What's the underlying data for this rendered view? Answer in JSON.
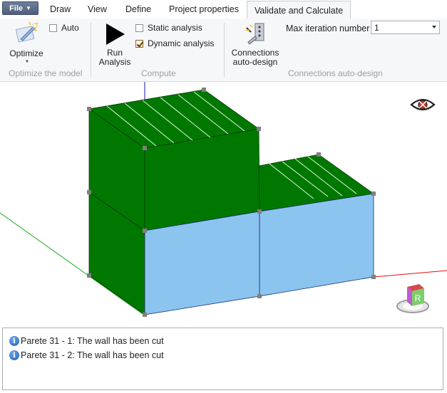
{
  "file_menu": {
    "label": "File"
  },
  "tabs": [
    "Draw",
    "View",
    "Define",
    "Project properties",
    "Validate and Calculate"
  ],
  "ribbon": {
    "optimize": {
      "label": "Optimize",
      "auto_label": "Auto",
      "auto_checked": false,
      "group_label": "Optimize the model"
    },
    "compute": {
      "run_line1": "Run",
      "run_line2": "Analysis",
      "static_label": "Static analysis",
      "static_checked": false,
      "dynamic_label": "Dynamic analysis",
      "dynamic_checked": true,
      "group_label": "Compute"
    },
    "connections": {
      "line1": "Connections",
      "line2": "auto-design",
      "iter_label": "Max iteration number",
      "iter_value": "1",
      "group_label": "Connections auto-design"
    }
  },
  "viewcube": {
    "face_label": "R"
  },
  "log": [
    "Parete 31 - 1: The wall has been cut",
    "Parete 31 - 2: The wall has been cut"
  ],
  "colors": {
    "wall_green": "#007800",
    "wall_blue": "#8bc4ef",
    "axis_red": "#e01010",
    "axis_green": "#1fa81f",
    "axis_blue": "#1a1a9a"
  }
}
